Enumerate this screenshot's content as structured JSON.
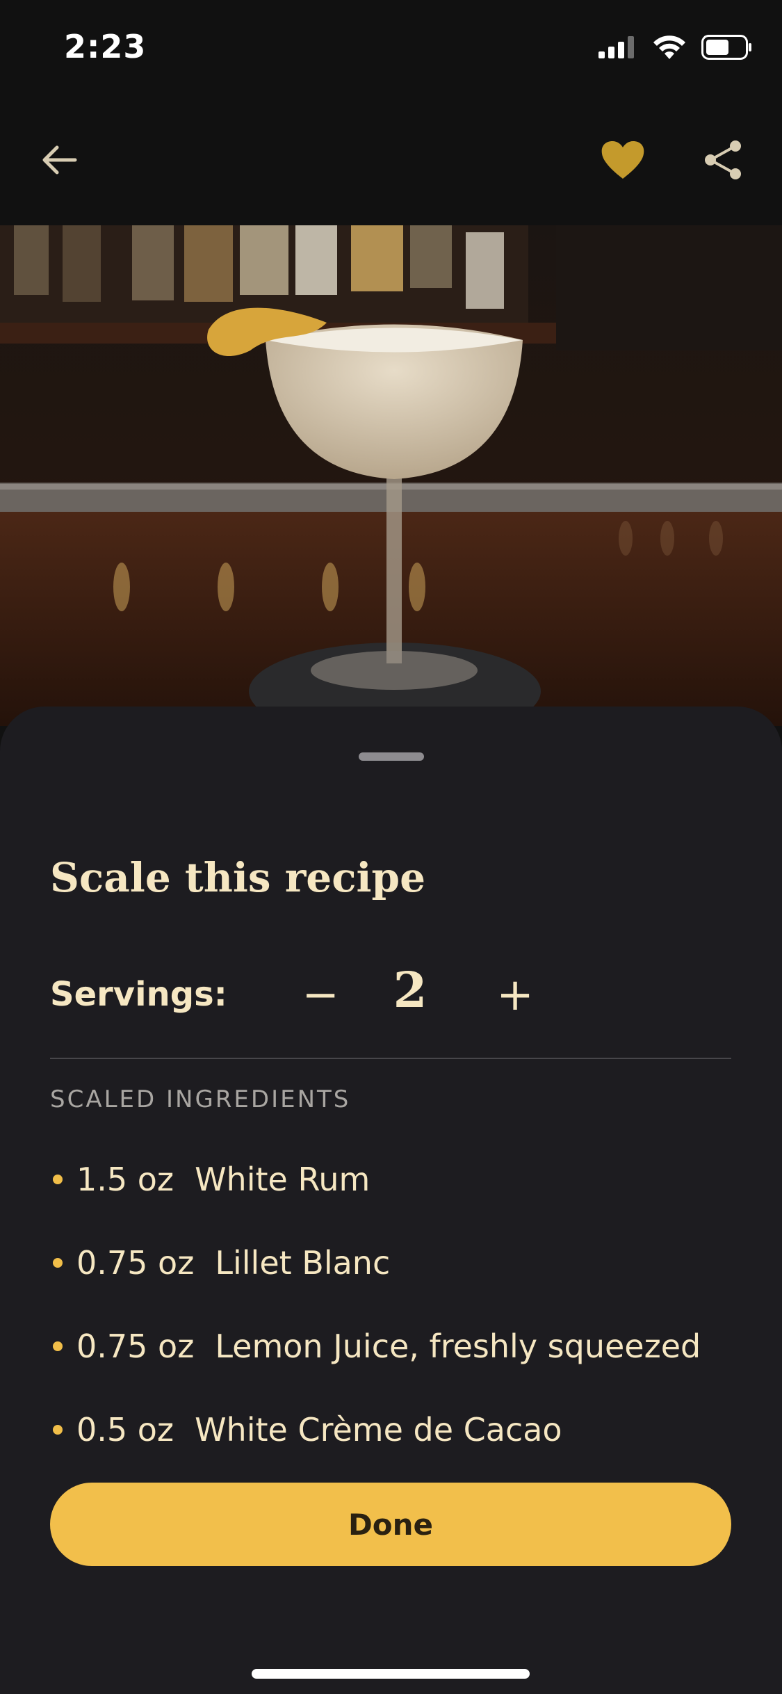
{
  "status_bar": {
    "time": "2:23"
  },
  "top_bar": {
    "back_icon": "arrow-left-icon",
    "favorite_icon": "heart-icon",
    "share_icon": "share-icon",
    "favorite_color": "#C49A2C"
  },
  "hero": {
    "description_icon": "cocktail-photo"
  },
  "sheet": {
    "title": "Scale this recipe",
    "servings_label": "Servings:",
    "minus_label": "−",
    "servings_value": "2",
    "plus_label": "+",
    "section_label": "SCALED INGREDIENTS",
    "ingredients": [
      {
        "amount": "1.5 oz",
        "name": "White Rum"
      },
      {
        "amount": "0.75 oz",
        "name": "Lillet Blanc"
      },
      {
        "amount": "0.75 oz",
        "name": "Lemon Juice, freshly squeezed"
      },
      {
        "amount": "0.5 oz",
        "name": "White Crème de Cacao"
      }
    ],
    "done_label": "Done",
    "accent": "#F2BF4B"
  }
}
